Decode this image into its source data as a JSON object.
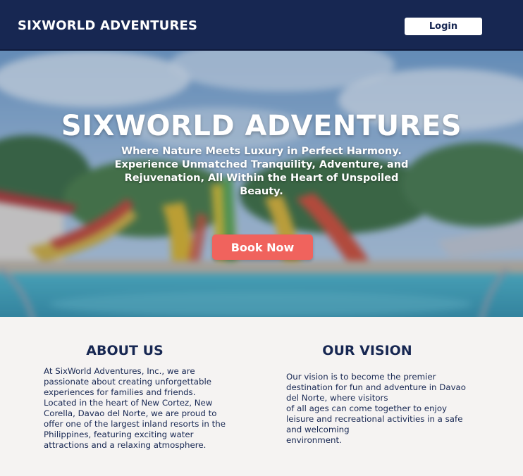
{
  "navbar": {
    "brand": "SIXWORLD ADVENTURES",
    "login_label": "Login"
  },
  "hero": {
    "title": "SIXWORLD ADVENTURES",
    "subtitle_lines": [
      "Where Nature Meets Luxury in Perfect Harmony.",
      "Experience Unmatched Tranquility, Adventure, and",
      "Rejuvenation, All Within the Heart of Unspoiled",
      "Beauty."
    ],
    "book_label": "Book Now"
  },
  "about": {
    "title": "ABOUT US",
    "lines": [
      "At SixWorld Adventures, Inc., we are",
      "passionate about creating unforgettable",
      "experiences for families and friends.",
      "Located in the heart of New Cortez, New",
      "Corella, Davao del Norte,  we are proud to",
      "offer one of the largest inland resorts in the",
      "Philippines, featuring exciting water",
      "attractions and a relaxing atmosphere."
    ]
  },
  "vision": {
    "title": "OUR VISION",
    "lines": [
      "Our vision is to become the premier",
      "destination for fun and adventure in Davao",
      "del Norte, where visitors",
      "of all ages can come together to enjoy",
      "leisure and recreational activities in a safe",
      "and welcoming",
      "environment."
    ]
  },
  "colors": {
    "navy": "#172752",
    "coral": "#f0635d",
    "page_bg": "#f5f3f2"
  }
}
